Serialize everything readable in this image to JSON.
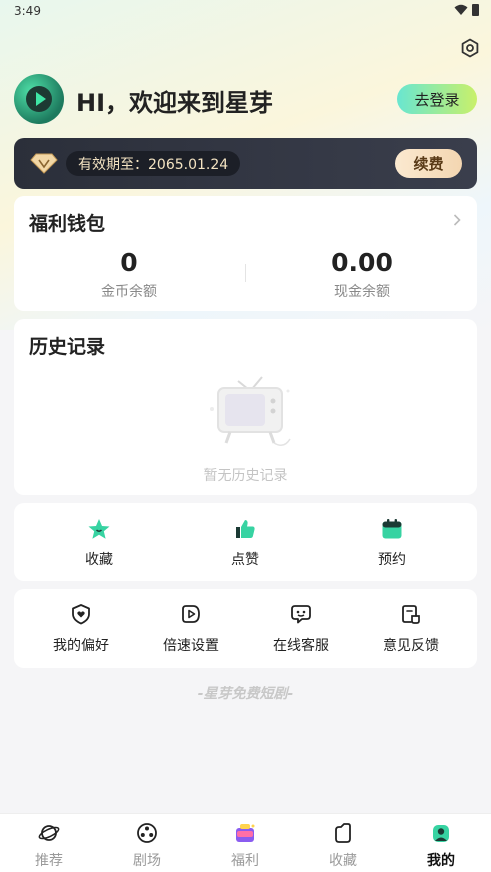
{
  "status_bar": {
    "time": "3:49"
  },
  "header": {
    "greeting": "HI，欢迎来到星芽",
    "login_label": "去登录"
  },
  "vip": {
    "expiry_text": "有效期至：2065.01.24",
    "renew_label": "续费"
  },
  "wallet": {
    "title": "福利钱包",
    "coins_value": "0",
    "coins_label": "金币余额",
    "cash_value": "0.00",
    "cash_label": "现金余额"
  },
  "history": {
    "title": "历史记录",
    "empty_text": "暂无历史记录"
  },
  "quick_actions": [
    {
      "label": "收藏",
      "icon": "star-icon"
    },
    {
      "label": "点赞",
      "icon": "thumbs-up-icon"
    },
    {
      "label": "预约",
      "icon": "calendar-icon"
    }
  ],
  "tools": [
    {
      "label": "我的偏好",
      "icon": "heart-shield-icon"
    },
    {
      "label": "倍速设置",
      "icon": "speed-icon"
    },
    {
      "label": "在线客服",
      "icon": "chat-bot-icon"
    },
    {
      "label": "意见反馈",
      "icon": "feedback-icon"
    }
  ],
  "footer_slogan": "-星芽免费短剧-",
  "bottom_nav": [
    {
      "label": "推荐",
      "icon": "planet-icon",
      "active": false
    },
    {
      "label": "剧场",
      "icon": "film-reel-icon",
      "active": false
    },
    {
      "label": "福利",
      "icon": "gift-icon",
      "active": false
    },
    {
      "label": "收藏",
      "icon": "bookmark-icon",
      "active": false
    },
    {
      "label": "我的",
      "icon": "profile-icon",
      "active": true
    }
  ],
  "colors": {
    "accent_green": "#3fd9a0",
    "vip_card": "#2b2f3a",
    "vip_gold": "#f3d6b1"
  }
}
